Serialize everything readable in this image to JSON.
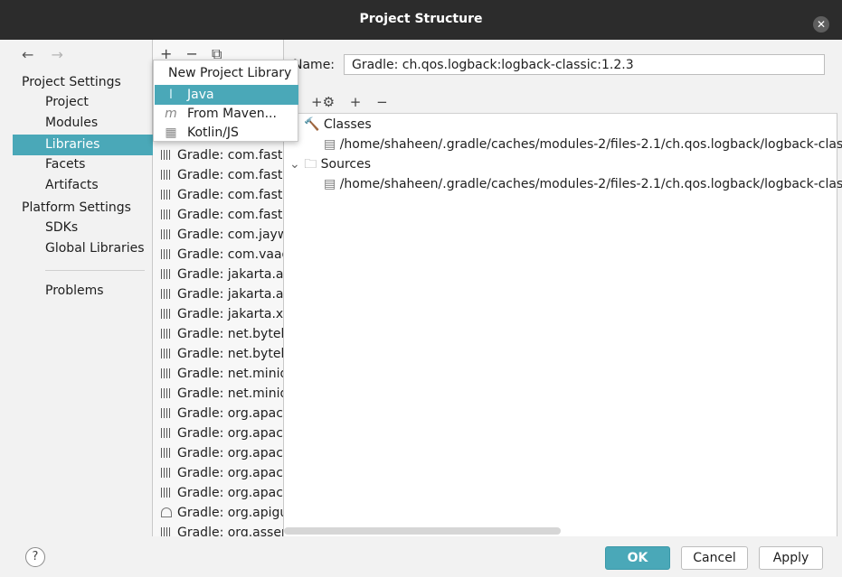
{
  "window": {
    "title": "Project Structure"
  },
  "nav": {
    "back": "←",
    "forward": "→"
  },
  "sidebar": {
    "project_settings_label": "Project Settings",
    "project_items": [
      "Project",
      "Modules",
      "Libraries",
      "Facets",
      "Artifacts"
    ],
    "platform_settings_label": "Platform Settings",
    "platform_items": [
      "SDKs",
      "Global Libraries"
    ],
    "problems": "Problems",
    "selected": "Libraries"
  },
  "libraries": {
    "toolbar": {
      "add": "+",
      "remove": "−",
      "copy": "⧉"
    },
    "items": [
      "Gradle: com.faste",
      "Gradle: com.faste",
      "Gradle: com.faste",
      "Gradle: com.faste",
      "Gradle: com.jayw",
      "Gradle: com.vaad",
      "Gradle: jakarta.ac",
      "Gradle: jakarta.ar",
      "Gradle: jakarta.xr",
      "Gradle: net.byteb",
      "Gradle: net.byteb",
      "Gradle: net.minid",
      "Gradle: net.minid",
      "Gradle: org.apach",
      "Gradle: org.apach",
      "Gradle: org.apach",
      "Gradle: org.apach",
      "Gradle: org.apach",
      "Gradle: org.apigu",
      "Gradle: org.asser"
    ]
  },
  "popup": {
    "title": "New Project Library",
    "items": [
      {
        "label": "Java",
        "icon": "Ⅰ"
      },
      {
        "label": "From Maven...",
        "icon": "m"
      },
      {
        "label": "Kotlin/JS",
        "icon": "▦"
      }
    ],
    "selected": "Java"
  },
  "detail": {
    "name_label": "Name:",
    "name_value": "Gradle: ch.qos.logback:logback-classic:1.2.3",
    "tree_tools": {
      "add_with": "+⚙",
      "add": "+",
      "remove": "−"
    },
    "tree": {
      "classes_label": "Classes",
      "classes_path": "/home/shaheen/.gradle/caches/modules-2/files-2.1/ch.qos.logback/logback-clas",
      "sources_label": "Sources",
      "sources_path": "/home/shaheen/.gradle/caches/modules-2/files-2.1/ch.qos.logback/logback-clas"
    }
  },
  "footer": {
    "help": "?",
    "ok": "OK",
    "cancel": "Cancel",
    "apply": "Apply"
  },
  "colors": {
    "accent": "#4aa8b8",
    "titlebar": "#2c2c2c"
  }
}
